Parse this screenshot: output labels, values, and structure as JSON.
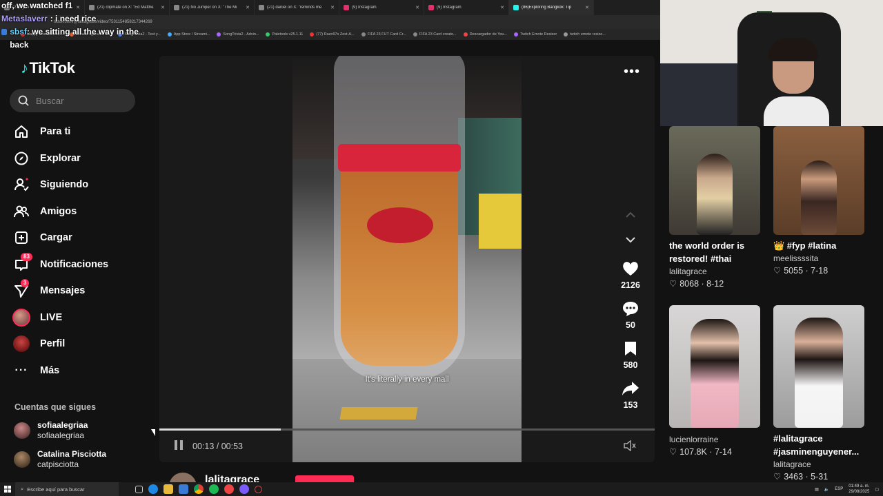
{
  "browser": {
    "tabs": [
      {
        "label": "(21) ryan on X: \"Cuffem in\"",
        "color": "#aaaaaa"
      },
      {
        "label": "(21) clipmate on X: \"Ed Matthe",
        "color": "#aaaaaa"
      },
      {
        "label": "(21) No Jumper on X: \"The Mi",
        "color": "#aaaaaa"
      },
      {
        "label": "(21) daniel on X: \"reminds me",
        "color": "#aaaaaa"
      },
      {
        "label": "(9) Instagram",
        "color": "#e1306c"
      },
      {
        "label": "(9) Instagram",
        "color": "#e1306c"
      },
      {
        "label": "(86)Exploring Bangkok: Tip",
        "color": "#25f4ee"
      }
    ],
    "url": "tiktok.com/@lalitagrace/video/7531154858217344269",
    "bookmarks": [
      {
        "label": "Happy Cristiano Ro...",
        "color": "#d33"
      },
      {
        "label": "Buraco figura de te...",
        "color": "#e63"
      },
      {
        "label": "SongTrivia2 - Test y...",
        "color": "#58f"
      },
      {
        "label": "App Store / Streami...",
        "color": "#4af"
      },
      {
        "label": "SongTrivia2 - Advin...",
        "color": "#a6f"
      },
      {
        "label": "Paletools v25.1.11",
        "color": "#3c6"
      },
      {
        "label": "(77) Razo97s Zest-A...",
        "color": "#e33"
      },
      {
        "label": "FIFA 23 FUT Card Cr...",
        "color": "#888"
      },
      {
        "label": "FIFA 23 Card creato...",
        "color": "#888"
      },
      {
        "label": "Descargador de You...",
        "color": "#e44"
      },
      {
        "label": "Twitch Emote Resizer",
        "color": "#a6f"
      },
      {
        "label": "twitch emote resize...",
        "color": "#999"
      }
    ]
  },
  "chat": [
    {
      "name": "",
      "msg": "off, we watched f1",
      "name_color": "#ffffff"
    },
    {
      "name": "Metaslaverr",
      "msg": ": i need rice",
      "name_color": "#b0a0ff"
    },
    {
      "name": "sbsf",
      "msg": ": we sitting all the way in the back",
      "name_color": "#6fd3ff"
    }
  ],
  "logo": {
    "text": "TikTok"
  },
  "search": {
    "placeholder": "Buscar"
  },
  "nav": [
    {
      "label": "Para ti",
      "icon": "home-icon"
    },
    {
      "label": "Explorar",
      "icon": "compass-icon"
    },
    {
      "label": "Siguiendo",
      "icon": "following-icon"
    },
    {
      "label": "Amigos",
      "icon": "friends-icon"
    },
    {
      "label": "Cargar",
      "icon": "upload-icon"
    },
    {
      "label": "Notificaciones",
      "icon": "inbox-icon",
      "badge": "83"
    },
    {
      "label": "Mensajes",
      "icon": "send-icon",
      "badge": "3"
    },
    {
      "label": "LIVE",
      "icon": "live-icon"
    },
    {
      "label": "Perfil",
      "icon": "profile-icon"
    },
    {
      "label": "Más",
      "icon": "more-icon"
    }
  ],
  "following": {
    "title": "Cuentas que sigues",
    "accounts": [
      {
        "name": "sofiaalegriaa",
        "handle": "sofiaalegriaa"
      },
      {
        "name": "Catalina Pisciotta",
        "handle": "catpisciotta"
      }
    ]
  },
  "video": {
    "subtitle": "It's literally in every mall",
    "time": "00:13 / 00:53",
    "progress": 0.245,
    "likes": "2126",
    "comments": "50",
    "saves": "580",
    "shares": "153",
    "author": "lalitagrace"
  },
  "recommended": [
    {
      "title": "the world order is restored! #thai",
      "user": "lalitagrace",
      "stats": "8068 · 8-12"
    },
    {
      "title": "👑 #fyp #latina",
      "user": "meelissssita",
      "stats": "5055 · 7-18"
    },
    {
      "title": "",
      "user": "lucienlorraine",
      "stats": "107.8K · 7-14"
    },
    {
      "title": "#lalitagrace #jasminenguyener...",
      "user": "lalitagrace",
      "stats": "3463 · 5-31"
    }
  ],
  "taskbar": {
    "search_placeholder": "Escribe aquí para buscar",
    "time": "01:49 a. m.",
    "date": "29/08/2025",
    "lang": "ESP"
  },
  "colors": {
    "accent": "#fe2c55",
    "tiktok_cyan": "#25f4ee",
    "bg": "#121212"
  }
}
